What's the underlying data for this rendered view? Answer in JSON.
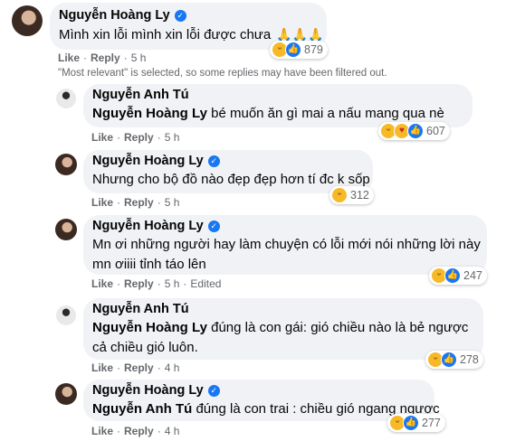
{
  "comments": [
    {
      "author": "Nguyễn Hoàng Ly",
      "verified": true,
      "text": "Mình xin lỗi mình xin lỗi được chưa",
      "emoji": "🙏🙏🙏",
      "like": "Like",
      "reply": "Reply",
      "time": "5 h",
      "reactions": "879"
    },
    {
      "author": "Nguyễn Anh Tú",
      "verified": false,
      "tag": "Nguyễn Hoàng Ly",
      "text": "bé muốn ăn gì mai a nấu mang qua nè",
      "like": "Like",
      "reply": "Reply",
      "time": "5 h",
      "reactions": "607"
    },
    {
      "author": "Nguyễn Hoàng Ly",
      "verified": true,
      "text": "Nhưng cho bộ đồ nào đẹp đẹp hơn tí đc k sốp",
      "like": "Like",
      "reply": "Reply",
      "time": "5 h",
      "reactions": "312"
    },
    {
      "author": "Nguyễn Hoàng Ly",
      "verified": true,
      "text_line1": "Mn ơi những người hay làm chuyện có lỗi mới nói những lời này",
      "text_line2": "mn ơiiii tỉnh táo lên",
      "like": "Like",
      "reply": "Reply",
      "time": "5 h",
      "edited": "Edited",
      "reactions": "247"
    },
    {
      "author": "Nguyễn Anh Tú",
      "verified": false,
      "tag": "Nguyễn Hoàng Ly",
      "text_line1": "đúng là con gái: gió chiều nào là bẻ ngược",
      "text_line2": "cả chiều gió luôn.",
      "like": "Like",
      "reply": "Reply",
      "time": "4 h",
      "reactions": "278"
    },
    {
      "author": "Nguyễn Hoàng Ly",
      "verified": true,
      "tag": "Nguyễn Anh Tú",
      "text": "đúng là con trai : chiều gió ngang ngược",
      "like": "Like",
      "reply": "Reply",
      "time": "4 h",
      "reactions": "277"
    }
  ],
  "filter_note": "\"Most relevant\" is selected, so some replies may have been filtered out.",
  "colors": {
    "bubble": "#f0f2f5",
    "muted": "#65676b",
    "verified": "#1877f2"
  }
}
